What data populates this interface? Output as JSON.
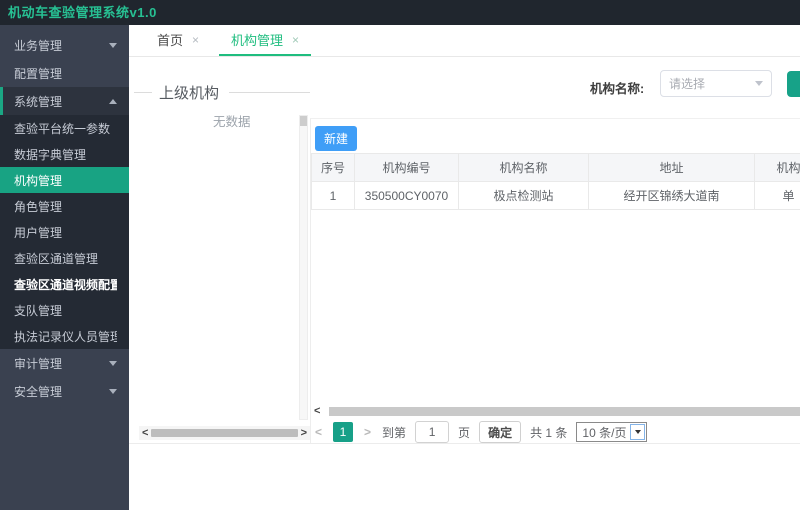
{
  "app": {
    "title": "机动车查验管理系统v1.0"
  },
  "colors": {
    "accent_teal": "#18a383",
    "tab_green": "#1fbd7f",
    "primary_blue": "#3f9ef7",
    "sidebar_dark": "#3a4150",
    "submenu_dark": "#242a34",
    "topbar_dark": "#20262e"
  },
  "sidebar": {
    "items": [
      {
        "label": "业务管理",
        "type": "group",
        "arrow": "down"
      },
      {
        "label": "配置管理",
        "type": "group",
        "arrow": ""
      },
      {
        "label": "系统管理",
        "type": "group",
        "arrow": "up",
        "expanded": true
      },
      {
        "label": "查验平台统一参数",
        "type": "sub"
      },
      {
        "label": "数据字典管理",
        "type": "sub"
      },
      {
        "label": "机构管理",
        "type": "sub",
        "active": true
      },
      {
        "label": "角色管理",
        "type": "sub"
      },
      {
        "label": "用户管理",
        "type": "sub"
      },
      {
        "label": "查验区通道管理",
        "type": "sub"
      },
      {
        "label": "查验区通道视频配置管理",
        "type": "sub",
        "bright": true
      },
      {
        "label": "支队管理",
        "type": "sub"
      },
      {
        "label": "执法记录仪人员管理",
        "type": "sub"
      },
      {
        "label": "审计管理",
        "type": "group",
        "arrow": "down"
      },
      {
        "label": "安全管理",
        "type": "group",
        "arrow": "down"
      }
    ]
  },
  "tabs": [
    {
      "label": "首页",
      "close": "×",
      "active": false
    },
    {
      "label": "机构管理",
      "close": "×",
      "active": true
    }
  ],
  "search": {
    "label": "机构名称:",
    "placeholder": "请选择"
  },
  "tree_panel": {
    "title": "上级机构",
    "empty": "无数据"
  },
  "toolbar": {
    "new_button": "新建"
  },
  "table": {
    "columns": [
      "序号",
      "机构编号",
      "机构名称",
      "地址",
      "机构"
    ],
    "rows": [
      [
        "1",
        "350500CY0070",
        "极点检测站",
        "经开区锦绣大道南",
        "单"
      ]
    ]
  },
  "pagination": {
    "prev": "<",
    "page": "1",
    "next": ">",
    "goto_label": "到第",
    "goto_value": "1",
    "page_label": "页",
    "confirm": "确定",
    "total": "共 1 条",
    "page_size": "10 条/页"
  },
  "icons": {
    "scroll_left": "<",
    "scroll_right": ">"
  }
}
